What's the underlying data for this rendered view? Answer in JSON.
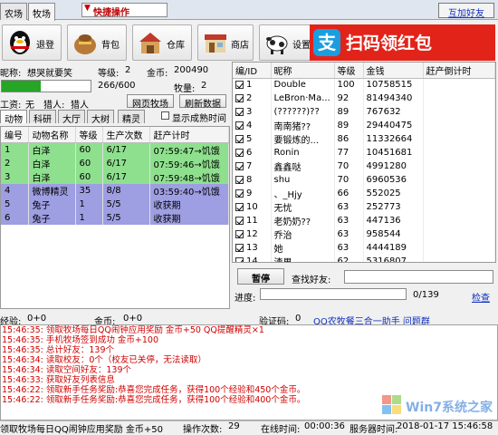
{
  "tabs": [
    "农场",
    "牧场"
  ],
  "quick_op": "快捷操作",
  "add_friend": "互加好友",
  "toolbar": {
    "logout": "退登",
    "bag": "背包",
    "warehouse": "仓库",
    "shop": "商店",
    "settings": "设置"
  },
  "ad": {
    "text": "扫码领红包",
    "logo_char": "支"
  },
  "info": {
    "nickname_label": "昵称:",
    "nickname": "想哭就要笑",
    "level_label": "等级:",
    "level": "2",
    "gold_label": "金币:",
    "gold": "200490",
    "exp": "266/600",
    "exp_fraction": 0.443,
    "pasture_label": "牧量:",
    "pasture": "2",
    "wage_label": "工资:",
    "wage": "无",
    "hunter_label": "猎人:",
    "hunter": "猎人",
    "web_pasture_btn": "网页牧场",
    "refresh_btn": "刷新数据",
    "show_time": "显示成熟时间"
  },
  "subtabs": [
    "动物",
    "科研",
    "大厅",
    "大树",
    "精灵"
  ],
  "animal_table": {
    "headers": [
      "编号",
      "动物名称",
      "等级",
      "生产次数",
      "赶产计时"
    ],
    "rows": [
      {
        "id": "1",
        "name": "白泽",
        "level": "60",
        "count": "6/17",
        "timer": "07:59:47→饥饿",
        "color": "green"
      },
      {
        "id": "2",
        "name": "白泽",
        "level": "60",
        "count": "6/17",
        "timer": "07:59:46→饥饿",
        "color": "green"
      },
      {
        "id": "3",
        "name": "白泽",
        "level": "60",
        "count": "6/17",
        "timer": "07:59:48→饥饿",
        "color": "green"
      },
      {
        "id": "4",
        "name": "微博精灵",
        "level": "35",
        "count": "8/8",
        "timer": "03:59:40→饥饿",
        "color": "purple"
      },
      {
        "id": "5",
        "name": "兔子",
        "level": "1",
        "count": "5/5",
        "timer": "收获期",
        "color": "purple"
      },
      {
        "id": "6",
        "name": "兔子",
        "level": "1",
        "count": "5/5",
        "timer": "收获期",
        "color": "purple"
      }
    ]
  },
  "friend_table": {
    "headers": [
      "编/ID",
      "昵称",
      "等级",
      "金钱",
      "赶产倒计时"
    ],
    "rows": [
      {
        "id": "1",
        "name": "Double",
        "level": "100",
        "money": "10758515"
      },
      {
        "id": "2",
        "name": "LeBron·Ma...",
        "level": "92",
        "money": "81494340"
      },
      {
        "id": "3",
        "name": "(??????)??",
        "level": "89",
        "money": "767632"
      },
      {
        "id": "4",
        "name": "南南猪??",
        "level": "89",
        "money": "29440475"
      },
      {
        "id": "5",
        "name": "要锻炼的...",
        "level": "86",
        "money": "11332664"
      },
      {
        "id": "6",
        "name": "Ronin",
        "level": "77",
        "money": "10451681"
      },
      {
        "id": "7",
        "name": "鑫鑫哒",
        "level": "70",
        "money": "4991280"
      },
      {
        "id": "8",
        "name": "shu",
        "level": "70",
        "money": "6960536"
      },
      {
        "id": "9",
        "name": "、_Hjy",
        "level": "66",
        "money": "552025"
      },
      {
        "id": "10",
        "name": "无忧",
        "level": "63",
        "money": "252773"
      },
      {
        "id": "11",
        "name": "老奶奶??",
        "level": "63",
        "money": "447136"
      },
      {
        "id": "12",
        "name": "乔治",
        "level": "63",
        "money": "958544"
      },
      {
        "id": "13",
        "name": "她",
        "level": "63",
        "money": "4444189"
      },
      {
        "id": "14",
        "name": "渣男",
        "level": "62",
        "money": "5316807"
      }
    ]
  },
  "pause_btn": "暂停",
  "search_label": "查找好友:",
  "progress_label": "进度:",
  "progress_text": "0/139",
  "check_link": "检查",
  "status": {
    "exp_label": "经验:",
    "exp_val": "0+0",
    "gold_label": "金币:",
    "gold_val": "0+0",
    "code_label": "验证码:",
    "code_val": "0",
    "group_link": "QQ农牧餐三合一助手 问题群"
  },
  "log_lines": [
    "15:46:35: 领取牧场每日QQ闹钟应用奖励 金币+50 QQ提醒精灵×1",
    "15:46:35: 手机牧场签到成功 金币+100",
    "15:46:35: 总计好友：139个",
    "15:46:34: 读取校友：0个（校友已关停，无法读取）",
    "15:46:34: 读取空间好友：139个",
    "15:46:33: 获取好友列表信息",
    "15:46:22: 领取新手任务奖励:恭喜您完成任务，获得100个经验和450个金币。",
    "15:46:22: 领取新手任务奖励:恭喜您完成任务，获得100个经验和400个金币。"
  ],
  "bottom": {
    "msg": "领取牧场每日QQ闹钟应用奖励 金币+50",
    "ops_label": "操作次数:",
    "ops": "29",
    "online_label": "在线时间:",
    "online": "00:00:36",
    "server_label": "服务器时间:",
    "server": "2018-01-17 15:46:58"
  },
  "watermark": "Win7系统之家"
}
